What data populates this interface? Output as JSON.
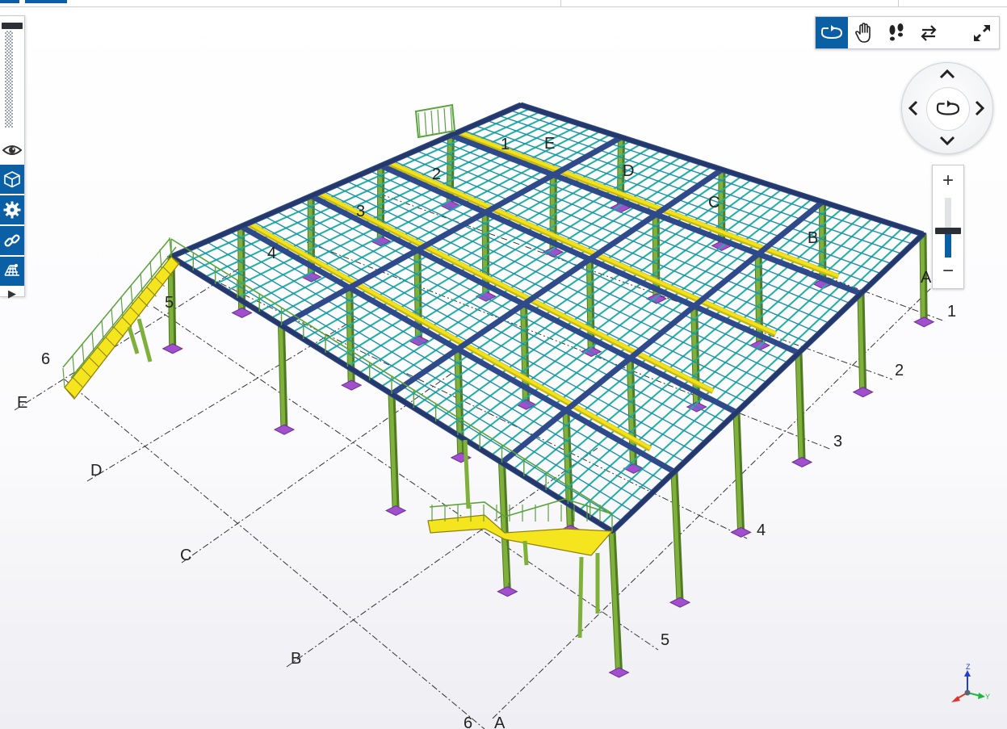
{
  "app": {
    "header_tabs": [
      "",
      ""
    ]
  },
  "model": {
    "grid_labels": {
      "numbers_right": [
        "1",
        "2",
        "3",
        "4",
        "5"
      ],
      "numbers_left": [
        "5",
        "6"
      ],
      "number_bottom": "6",
      "letters_left": [
        "E",
        "D",
        "C",
        "B"
      ],
      "letter_bottom": "A",
      "letter_right": "A",
      "roof_numbers": [
        "1",
        "2",
        "3",
        "4"
      ],
      "roof_letters": [
        "E",
        "D",
        "C",
        "B"
      ]
    },
    "colors": {
      "beam_main": "#2f4a8a",
      "beam_secondary": "#2fa39a",
      "grating": "#1fb0a3",
      "beam_highlight": "#f2e21a",
      "column": "#7fb03c",
      "base_plate": "#a24fcf",
      "stair": "#f5e51e"
    }
  },
  "left_toolbar": {
    "buttons": [
      {
        "name": "opacity-slider",
        "level": 0.9
      },
      {
        "name": "eye-icon"
      },
      {
        "name": "box-icon"
      },
      {
        "name": "gear-icon"
      },
      {
        "name": "link-icon"
      },
      {
        "name": "mesh-icon"
      },
      {
        "name": "expand-icon",
        "glyph": "▶"
      }
    ]
  },
  "nav_toolbar": {
    "buttons": [
      {
        "name": "orbit-icon",
        "active": true
      },
      {
        "name": "pan-hand-icon",
        "active": false
      },
      {
        "name": "walk-icon",
        "active": false
      },
      {
        "name": "swap-icon",
        "active": false
      },
      {
        "name": "fullscreen-icon",
        "active": false
      }
    ]
  },
  "zoom": {
    "plus": "+",
    "minus": "−",
    "level": 0.55
  },
  "triad": {
    "z": "Z",
    "y": "Y"
  }
}
